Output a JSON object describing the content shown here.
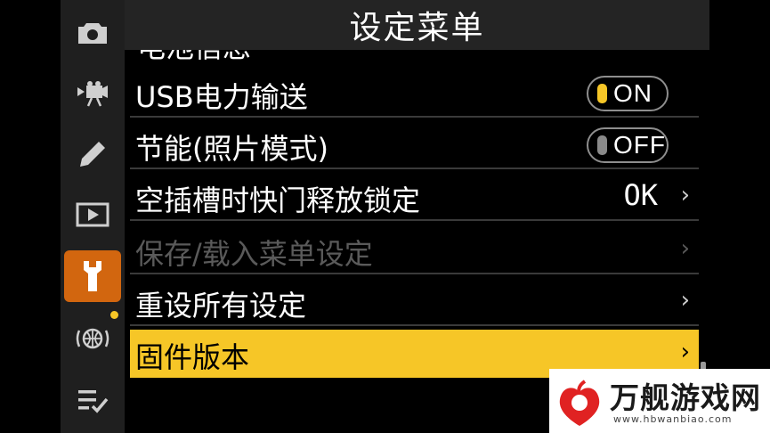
{
  "header": {
    "title": "设定菜单"
  },
  "sidebar": {
    "items": [
      {
        "icon": "camera-icon"
      },
      {
        "icon": "movie-icon"
      },
      {
        "icon": "pencil-icon"
      },
      {
        "icon": "playback-icon"
      },
      {
        "icon": "wrench-icon",
        "active": true
      },
      {
        "icon": "network-icon",
        "badge": true
      },
      {
        "icon": "my-menu-icon"
      }
    ]
  },
  "menu": {
    "cutoff_label": "电池信息",
    "items": [
      {
        "label": "USB电力输送",
        "toggle": "ON"
      },
      {
        "label": "节能(照片模式)",
        "toggle": "OFF"
      },
      {
        "label": "空插槽时快门释放锁定",
        "value": "OK"
      },
      {
        "label": "保存/载入菜单设定",
        "disabled": true
      },
      {
        "label": "重设所有设定"
      },
      {
        "label": "固件版本",
        "selected": true
      }
    ],
    "chevron": "›"
  },
  "watermark": {
    "title": "万舰游戏网",
    "url": "www.hbwanbiao.com"
  },
  "colors": {
    "accent": "#f6c627",
    "active_tab": "#d2660f"
  }
}
